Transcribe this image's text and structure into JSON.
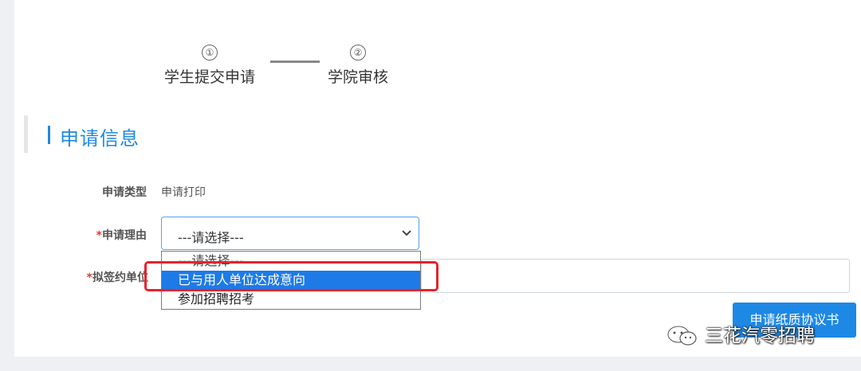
{
  "steps": [
    {
      "num": "①",
      "label": "学生提交申请"
    },
    {
      "num": "②",
      "label": "学院审核"
    }
  ],
  "section": {
    "title": "申请信息"
  },
  "form": {
    "type_label": "申请类型",
    "type_value": "申请打印",
    "reason_required": "*",
    "reason_label": "申请理由",
    "reason_value": "---请选择---",
    "unit_required": "*",
    "unit_label": "拟签约单位"
  },
  "dropdown": {
    "options": [
      "---请选择---",
      "已与用人单位达成意向",
      "参加招聘招考"
    ],
    "highlighted_index": 1
  },
  "button": {
    "label": "申请纸质协议书"
  },
  "watermark": {
    "text": "三花汽零招聘"
  },
  "colors": {
    "accent": "#1e88e5",
    "highlight_border": "#e8232b",
    "selected_option": "#1e7ae6",
    "required": "#e53935"
  }
}
